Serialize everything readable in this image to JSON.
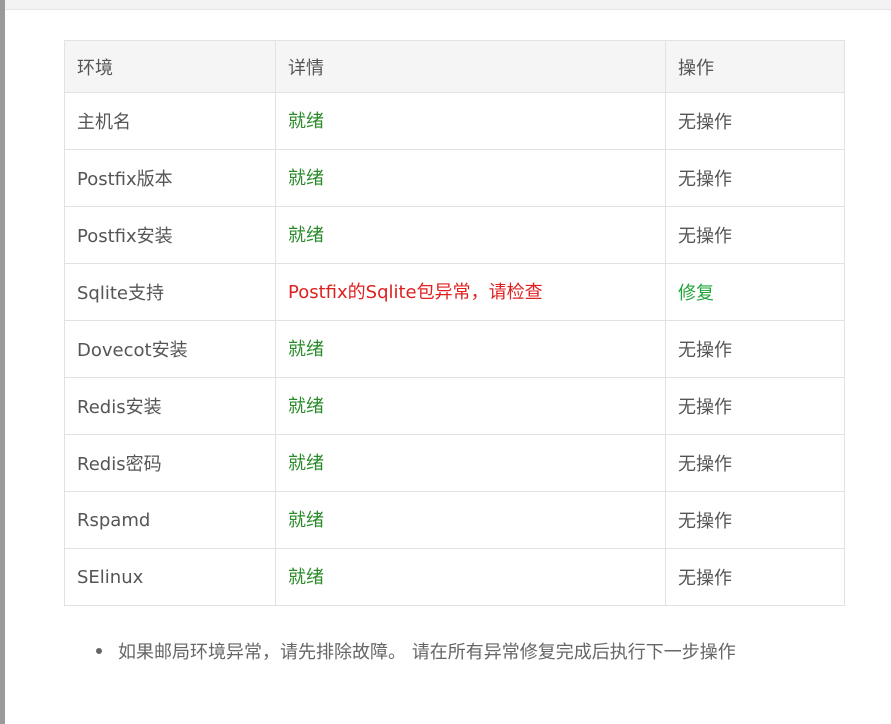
{
  "table": {
    "headers": [
      "环境",
      "详情",
      "操作"
    ],
    "rows": [
      {
        "env": "主机名",
        "detail": "就绪",
        "status": "ok",
        "action": "无操作",
        "action_link": false
      },
      {
        "env": "Postfix版本",
        "detail": "就绪",
        "status": "ok",
        "action": "无操作",
        "action_link": false
      },
      {
        "env": "Postfix安装",
        "detail": "就绪",
        "status": "ok",
        "action": "无操作",
        "action_link": false
      },
      {
        "env": "Sqlite支持",
        "detail": "Postfix的Sqlite包异常，请检查",
        "status": "error",
        "action": "修复",
        "action_link": true
      },
      {
        "env": "Dovecot安装",
        "detail": "就绪",
        "status": "ok",
        "action": "无操作",
        "action_link": false
      },
      {
        "env": "Redis安装",
        "detail": "就绪",
        "status": "ok",
        "action": "无操作",
        "action_link": false
      },
      {
        "env": "Redis密码",
        "detail": "就绪",
        "status": "ok",
        "action": "无操作",
        "action_link": false
      },
      {
        "env": "Rspamd",
        "detail": "就绪",
        "status": "ok",
        "action": "无操作",
        "action_link": false
      },
      {
        "env": "SElinux",
        "detail": "就绪",
        "status": "ok",
        "action": "无操作",
        "action_link": false
      }
    ]
  },
  "note": "如果邮局环境异常，请先排除故障。 请在所有异常修复完成后执行下一步操作",
  "colors": {
    "ok": "#2a8a2a",
    "error": "#e02020",
    "link": "#20a53a"
  }
}
